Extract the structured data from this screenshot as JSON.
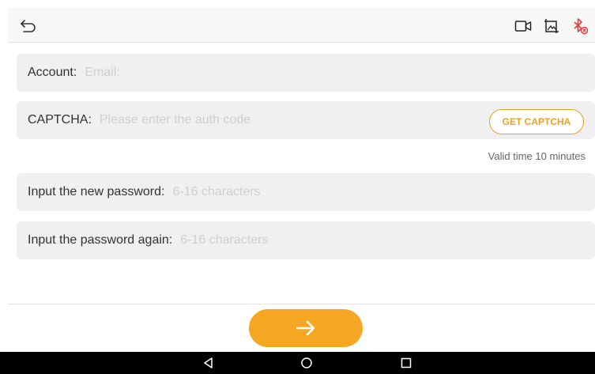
{
  "fields": {
    "account": {
      "label": "Account:",
      "placeholder": "Email:"
    },
    "captcha": {
      "label": "CAPTCHA:",
      "placeholder": "Please enter the auth code",
      "button_label": "GET CAPTCHA"
    },
    "new_password": {
      "label": "Input the new password:",
      "placeholder": "6-16 characters"
    },
    "confirm_password": {
      "label": "Input the password again:",
      "placeholder": "6-16 characters"
    }
  },
  "valid_time": "Valid time 10 minutes",
  "icons": {
    "back": "back-arrow-icon",
    "video": "video-camera-icon",
    "image": "image-icon",
    "bluetooth": "bluetooth-off-icon",
    "next": "arrow-right-icon",
    "nav_back": "triangle-back-icon",
    "nav_home": "circle-home-icon",
    "nav_recent": "square-recent-icon"
  },
  "colors": {
    "accent": "#f5a623",
    "captcha_text": "#f0a020",
    "bluetooth_off": "#e53935",
    "field_bg": "#f0f0f0"
  }
}
